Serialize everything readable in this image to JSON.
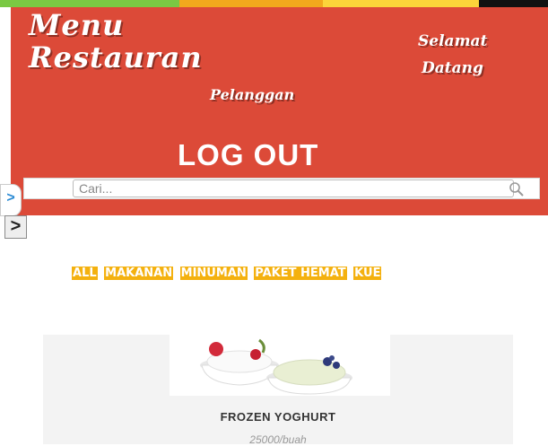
{
  "top_strip_colors": [
    "#7ac943",
    "#f2a81d",
    "#fbd43a",
    "#111111"
  ],
  "header": {
    "bg_color": "#dc4a38",
    "brand_line1": "Menu",
    "brand_line2": "Restauran",
    "greeting_line1": "Selamat",
    "greeting_line2": "Datang",
    "greeting_line3": "Pelanggan",
    "logout_label": "LOG OUT"
  },
  "search": {
    "placeholder": "Cari...",
    "value": "",
    "icon": "search-icon"
  },
  "side_toggles": {
    "first": ">",
    "second": ">"
  },
  "categories": [
    "ALL",
    "MAKANAN",
    "MINUMAN",
    "PAKET HEMAT",
    "KUE"
  ],
  "category_color": "#f4b10f",
  "product": {
    "name": "FROZEN YOGHURT",
    "price": "25000/buah",
    "image": "frozen-yoghurt-image"
  }
}
